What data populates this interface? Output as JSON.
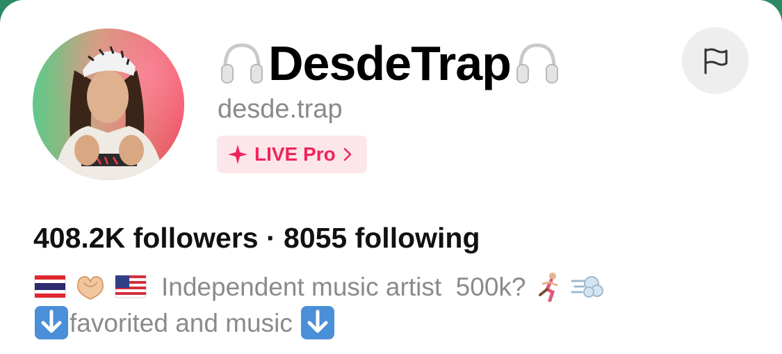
{
  "profile": {
    "display_name": "DesdeTrap",
    "name_prefix_icon": "headphones-icon",
    "name_suffix_icon": "headphones-icon",
    "handle": "desde.trap",
    "badge": {
      "icon": "sparkle-icon",
      "label": "LIVE Pro",
      "color": "#f0245a",
      "background": "#fde6ea"
    },
    "report_icon": "flag-icon"
  },
  "stats": {
    "text": "408.2K followers · 8055 following"
  },
  "bio": {
    "line1_prefix_emojis": [
      "thailand-flag-icon",
      "heart-hands-icon",
      "usa-flag-icon"
    ],
    "line1_text": "Independent music artist  500k?",
    "line1_suffix_emojis": [
      "running-man-icon",
      "dash-icon"
    ],
    "line2_text": "favorited and music",
    "line2_emojis": [
      "down-arrow-icon",
      "down-arrow-icon"
    ]
  },
  "colors": {
    "background_top": "#2a8a66",
    "text_primary": "#000000",
    "text_secondary": "#8a8a8e"
  }
}
